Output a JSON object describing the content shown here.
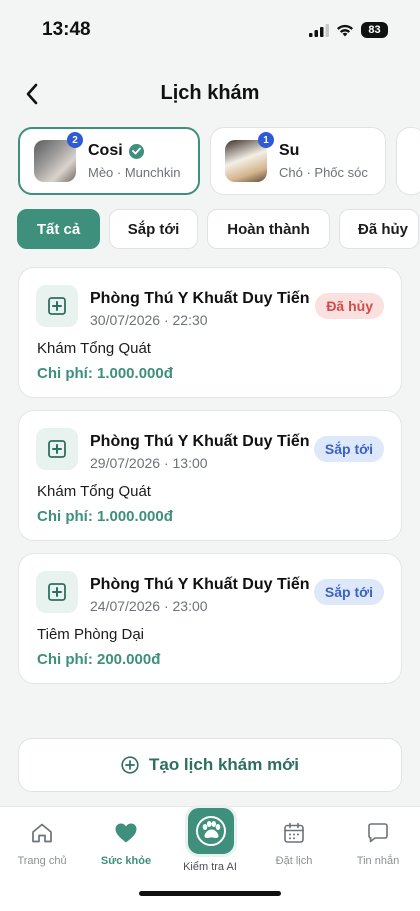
{
  "status_bar": {
    "time": "13:48",
    "battery": "83"
  },
  "header": {
    "title": "Lịch khám"
  },
  "pets": [
    {
      "name": "Cosi",
      "subtitle": "Mèo · Munchkin",
      "badge": "2",
      "verified": true,
      "selected": true
    },
    {
      "name": "Su",
      "subtitle": "Chó · Phốc sóc",
      "badge": "1",
      "verified": false,
      "selected": false
    }
  ],
  "tabs": [
    {
      "label": "Tất cả",
      "active": true
    },
    {
      "label": "Sắp tới",
      "active": false
    },
    {
      "label": "Hoàn thành",
      "active": false
    },
    {
      "label": "Đã hủy",
      "active": false
    }
  ],
  "appointments": [
    {
      "clinic": "Phòng Thú Y Khuất Duy Tiến",
      "datetime": "30/07/2026 · 22:30",
      "service": "Khám Tổng Quát",
      "cost": "Chi phí: 1.000.000đ",
      "status": "Đã hủy"
    },
    {
      "clinic": "Phòng Thú Y Khuất Duy Tiến",
      "datetime": "29/07/2026 · 13:00",
      "service": "Khám Tổng Quát",
      "cost": "Chi phí: 1.000.000đ",
      "status": "Sắp tới"
    },
    {
      "clinic": "Phòng Thú Y Khuất Duy Tiến",
      "datetime": "24/07/2026 · 23:00",
      "service": "Tiêm Phòng Dại",
      "cost": "Chi phí: 200.000đ",
      "status": "Sắp tới"
    }
  ],
  "create_button": {
    "label": "Tạo lịch khám mới"
  },
  "bottom_nav": {
    "items": [
      {
        "label": "Trang chủ",
        "icon": "home-icon",
        "active": false
      },
      {
        "label": "Sức khỏe",
        "icon": "heart-icon",
        "active": true
      },
      {
        "label": "Kiểm tra AI",
        "icon": "paw-scan-icon",
        "active": false
      },
      {
        "label": "Đặt lịch",
        "icon": "calendar-icon",
        "active": false
      },
      {
        "label": "Tin nhắn",
        "icon": "chat-icon",
        "active": false
      }
    ]
  },
  "colors": {
    "accent": "#3e8f7c",
    "cancel_bg": "#fbe0e0",
    "cancel_text": "#d14b4b",
    "upcoming_bg": "#dde8fb",
    "upcoming_text": "#3b62c4"
  }
}
